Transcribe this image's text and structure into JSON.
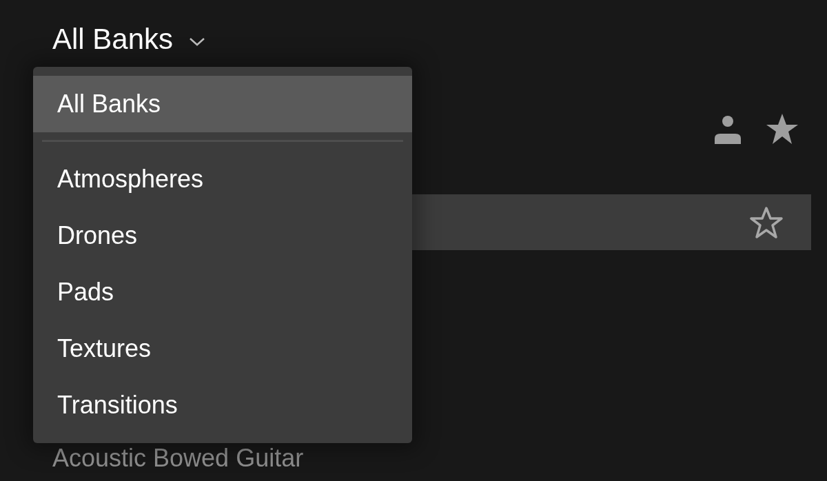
{
  "header": {
    "title": "All Banks"
  },
  "rows": [
    {
      "selected": true,
      "favorite": false
    },
    {
      "name": "Acoustic Bowed Guitar",
      "selected": false
    }
  ],
  "menu": {
    "items": [
      {
        "label": "All Banks",
        "selected": true
      },
      {
        "label": "Atmospheres",
        "selected": false
      },
      {
        "label": "Drones",
        "selected": false
      },
      {
        "label": "Pads",
        "selected": false
      },
      {
        "label": "Textures",
        "selected": false
      },
      {
        "label": "Transitions",
        "selected": false
      }
    ]
  }
}
